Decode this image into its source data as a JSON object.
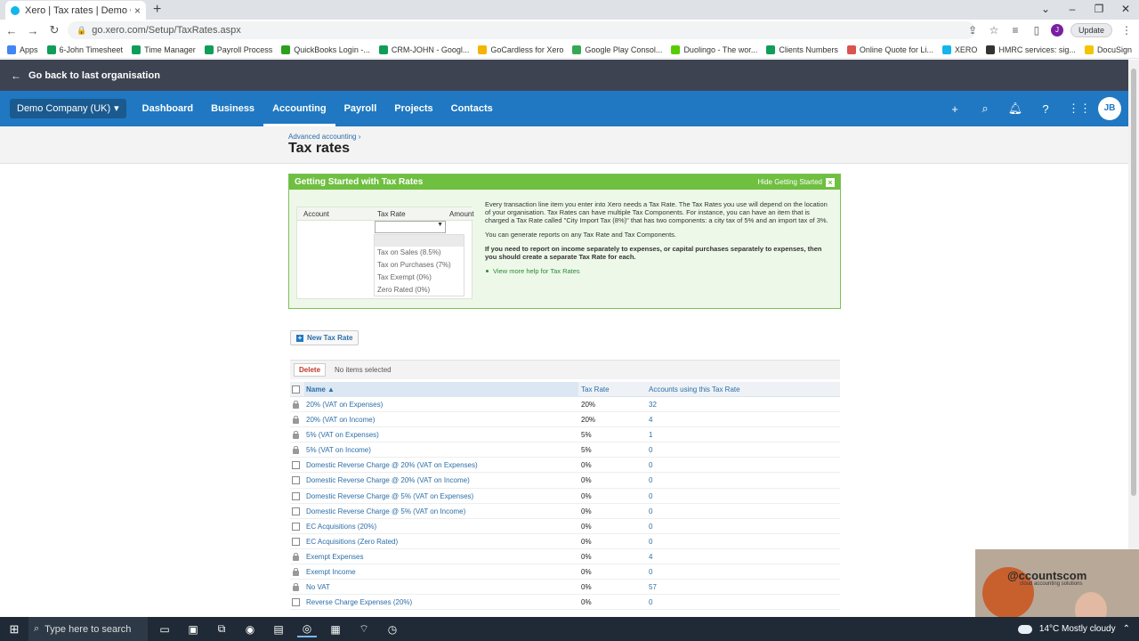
{
  "browser": {
    "tab_title": "Xero | Tax rates | Demo Company",
    "tab_close": "×",
    "new_tab": "+",
    "url": "go.xero.com/Setup/TaxRates.aspx",
    "update_label": "Update",
    "profile_initial": "J",
    "bookmarks": [
      {
        "label": "Apps",
        "color": "#4285f4"
      },
      {
        "label": "6-John Timesheet",
        "color": "#0f9d58"
      },
      {
        "label": "Time Manager",
        "color": "#0f9d58"
      },
      {
        "label": "Payroll Process",
        "color": "#0f9d58"
      },
      {
        "label": "QuickBooks Login -...",
        "color": "#2ca01c"
      },
      {
        "label": "CRM-JOHN - Googl...",
        "color": "#0f9d58"
      },
      {
        "label": "GoCardless for Xero",
        "color": "#f4b400"
      },
      {
        "label": "Google Play Consol...",
        "color": "#34a853"
      },
      {
        "label": "Duolingo - The wor...",
        "color": "#58cc02"
      },
      {
        "label": "Clients Numbers",
        "color": "#0f9d58"
      },
      {
        "label": "Online Quote for Li...",
        "color": "#d9534f"
      },
      {
        "label": "XERO",
        "color": "#13b5ea"
      },
      {
        "label": "HMRC services: sig...",
        "color": "#333333"
      },
      {
        "label": "DocuSign",
        "color": "#f4c400"
      }
    ]
  },
  "xero": {
    "back_label": "Go back to last organisation",
    "org_name": "Demo Company (UK)",
    "nav": [
      {
        "label": "Dashboard",
        "active": false
      },
      {
        "label": "Business",
        "active": false
      },
      {
        "label": "Accounting",
        "active": true
      },
      {
        "label": "Payroll",
        "active": false
      },
      {
        "label": "Projects",
        "active": false
      },
      {
        "label": "Contacts",
        "active": false
      }
    ],
    "avatar_initials": "JB"
  },
  "page": {
    "breadcrumb": "Advanced accounting ›",
    "title": "Tax rates"
  },
  "getting_started": {
    "title": "Getting Started with Tax Rates",
    "hide_label": "Hide Getting Started",
    "illustration": {
      "col_account": "Account",
      "col_tax_rate": "Tax Rate",
      "col_amount": "Amount",
      "options": [
        "Tax on Sales (8.5%)",
        "Tax on Purchases (7%)",
        "Tax Exempt (0%)",
        "Zero Rated (0%)"
      ]
    },
    "para1": "Every transaction line item you enter into Xero needs a Tax Rate. The Tax Rates you use will depend on the location of your organisation. Tax Rates can have multiple Tax Components. For instance, you can have an item that is charged a Tax Rate called \"City Import Tax (8%)\" that has two components: a city tax of 5% and an import tax of 3%.",
    "para2": "You can generate reports on any Tax Rate and Tax Components.",
    "para3": "If you need to report on income separately to expenses, or capital purchases separately to expenses, then you should create a separate Tax Rate for each.",
    "help_link": "View more help for Tax Rates"
  },
  "actions": {
    "new_label": "New Tax Rate",
    "delete_label": "Delete",
    "selection_status": "No items selected"
  },
  "table": {
    "col_name": "Name ▲",
    "col_rate": "Tax Rate",
    "col_accounts": "Accounts using this Tax Rate",
    "rows": [
      {
        "name": "20% (VAT on Expenses)",
        "rate": "20%",
        "accounts": "32",
        "locked": true
      },
      {
        "name": "20% (VAT on Income)",
        "rate": "20%",
        "accounts": "4",
        "locked": true
      },
      {
        "name": "5% (VAT on Expenses)",
        "rate": "5%",
        "accounts": "1",
        "locked": true
      },
      {
        "name": "5% (VAT on Income)",
        "rate": "5%",
        "accounts": "0",
        "locked": true
      },
      {
        "name": "Domestic Reverse Charge @ 20% (VAT on Expenses)",
        "rate": "0%",
        "accounts": "0",
        "locked": false
      },
      {
        "name": "Domestic Reverse Charge @ 20% (VAT on Income)",
        "rate": "0%",
        "accounts": "0",
        "locked": false
      },
      {
        "name": "Domestic Reverse Charge @ 5% (VAT on Expenses)",
        "rate": "0%",
        "accounts": "0",
        "locked": false
      },
      {
        "name": "Domestic Reverse Charge @ 5% (VAT on Income)",
        "rate": "0%",
        "accounts": "0",
        "locked": false
      },
      {
        "name": "EC Acquisitions (20%)",
        "rate": "0%",
        "accounts": "0",
        "locked": false
      },
      {
        "name": "EC Acquisitions (Zero Rated)",
        "rate": "0%",
        "accounts": "0",
        "locked": false
      },
      {
        "name": "Exempt Expenses",
        "rate": "0%",
        "accounts": "4",
        "locked": true
      },
      {
        "name": "Exempt Income",
        "rate": "0%",
        "accounts": "0",
        "locked": true
      },
      {
        "name": "No VAT",
        "rate": "0%",
        "accounts": "57",
        "locked": true
      },
      {
        "name": "Reverse Charge Expenses (20%)",
        "rate": "0%",
        "accounts": "0",
        "locked": false
      }
    ]
  },
  "webcam": {
    "logo": "@ccountscom",
    "tagline": "cloud accounting solutions"
  },
  "taskbar": {
    "search_placeholder": "Type here to search",
    "weather": "14°C  Mostly cloudy"
  }
}
